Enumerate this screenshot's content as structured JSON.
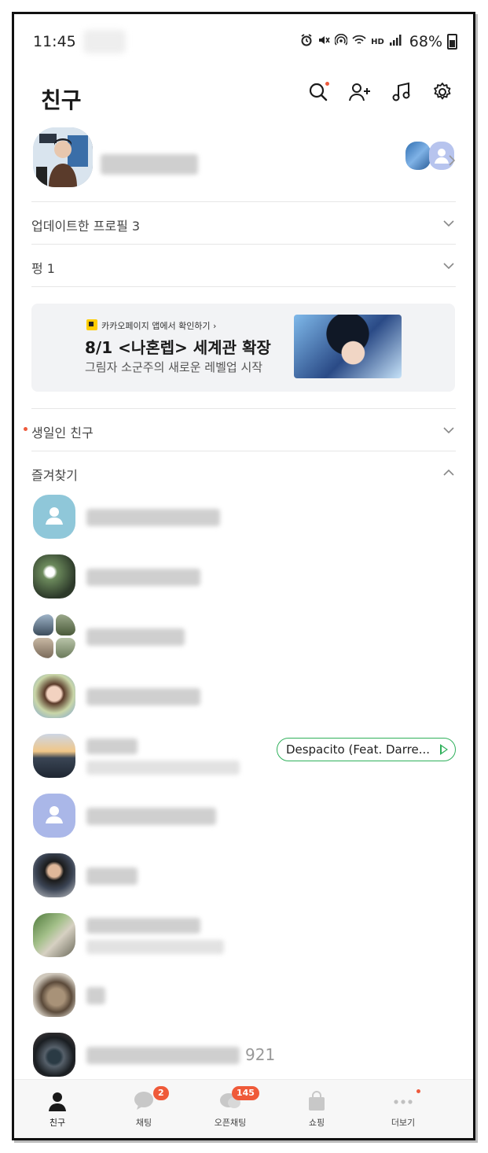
{
  "status_bar": {
    "time": "11:45",
    "battery": "68%",
    "network_label": "HD"
  },
  "header": {
    "title": "친구",
    "icons": [
      "search-icon",
      "add-friend-icon",
      "music-icon",
      "settings-icon"
    ]
  },
  "profile": {
    "name_hidden": true
  },
  "sections": {
    "updated_profiles": "업데이트한 프로필 3",
    "pyeong": "펑 1",
    "birthday_friends": "생일인 친구",
    "favorites": "즐겨찾기"
  },
  "banner": {
    "source": "카카오페이지 앱에서 확인하기 ›",
    "title": "8/1 <나혼렙> 세계관 확장",
    "subtitle": "그림자 소군주의 새로운 레벨업 시작"
  },
  "favorites": [
    {
      "avatar": "default-teal",
      "music": ""
    },
    {
      "avatar": "photo",
      "music": ""
    },
    {
      "avatar": "grid-photo",
      "music": ""
    },
    {
      "avatar": "photo",
      "music": ""
    },
    {
      "avatar": "sunset-photo",
      "music": "Despacito (Feat. Darre..."
    },
    {
      "avatar": "default-lavender",
      "music": ""
    },
    {
      "avatar": "photo",
      "music": ""
    },
    {
      "avatar": "photo",
      "music": ""
    },
    {
      "avatar": "cat-photo",
      "music": ""
    },
    {
      "avatar": "record-photo",
      "music": "",
      "suffix": "921"
    }
  ],
  "bottom_nav": {
    "items": [
      {
        "label": "친구",
        "badge": ""
      },
      {
        "label": "채팅",
        "badge": "2"
      },
      {
        "label": "오픈채팅",
        "badge": "145"
      },
      {
        "label": "쇼핑",
        "badge": ""
      },
      {
        "label": "더보기",
        "badge": ""
      }
    ]
  },
  "colors": {
    "accent_orange": "#ef5a39",
    "music_green": "#2fb05b",
    "kakaopage_yellow": "#ffcd00"
  }
}
